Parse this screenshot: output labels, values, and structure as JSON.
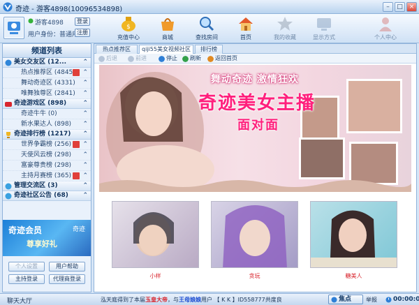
{
  "window": {
    "title": "奇迹 - 游客4898(10096534898)"
  },
  "user": {
    "name": "游客4898",
    "role_label": "用户身份：普通用户",
    "login_label": "登录",
    "register_label": "注册"
  },
  "toolbar": [
    {
      "label": "充值中心",
      "icon": "coin-bag-icon"
    },
    {
      "label": "商城",
      "icon": "shop-icon"
    },
    {
      "label": "查找房间",
      "icon": "search-icon"
    },
    {
      "label": "首页",
      "icon": "home-icon"
    },
    {
      "label": "我的收藏",
      "icon": "star-icon"
    },
    {
      "label": "显示方式",
      "icon": "display-mode-icon"
    },
    {
      "label": "个人中心",
      "icon": "person-icon"
    }
  ],
  "sidebar": {
    "title": "频道列表",
    "categories": [
      {
        "label": "美女交友区 (12...",
        "icon": "globe-icon",
        "items": [
          {
            "label": "热点推荐区 (4845)"
          },
          {
            "label": "舞动奇迹区 (4331)"
          },
          {
            "label": "唯舞独尊区 (2841)"
          }
        ]
      },
      {
        "label": "奇迹游戏区 (898)",
        "icon": "game-icon",
        "items": [
          {
            "label": "奇迹牛牛 (0)"
          },
          {
            "label": "新水果达人 (898)"
          }
        ]
      },
      {
        "label": "奇迹排行榜 (1217)",
        "icon": "trophy-icon",
        "items": [
          {
            "label": "世界争霸榜 (256)"
          },
          {
            "label": "天使风云榜 (298)"
          },
          {
            "label": "富豪尊贵榜 (298)"
          },
          {
            "label": "主持月赛榜 (365)"
          }
        ]
      },
      {
        "label": "管理交流区 (3)",
        "icon": "admin-icon",
        "items": []
      },
      {
        "label": "奇迹社区公告 (68)",
        "icon": "notice-icon",
        "items": []
      }
    ],
    "promo": {
      "line1": "奇迹会员",
      "line2": "尊享好礼",
      "brand": "奇迹"
    },
    "buttons": {
      "personal_settings": "个人设置",
      "user_help": "用户帮助",
      "host_login": "主持登录",
      "agent_login": "代理商登录"
    }
  },
  "main": {
    "tabs": [
      {
        "label": "热点推荐区 (4845)"
      },
      {
        "label": "qiji55美女视频社区"
      },
      {
        "label": "排行榜"
      }
    ],
    "nav": {
      "back": "后退",
      "forward": "前进",
      "stop": "停止",
      "refresh": "刷新",
      "home": "返回首页"
    },
    "banner": {
      "line1": "舞动奇迹  激情狂欢",
      "line2": "奇迹美女主播",
      "line3": "面对面"
    },
    "thumbnails": [
      {
        "caption": "小样"
      },
      {
        "caption": "贪玩"
      },
      {
        "caption": "糖美人"
      }
    ]
  },
  "statusbar": {
    "left": "聊天大厅",
    "marquee_prefix": "泓天庭得到了本届",
    "marquee_title": "玉皇大帝",
    "marquee_mid": "，与",
    "marquee_name": "王母娘娘",
    "marquee_suffix": "用户 【 K  K 】ID558777共度良",
    "focus_label": "焦点",
    "report_label": "举报",
    "timer": "00:00:00"
  },
  "colors": {
    "accent": "#1c7fd8",
    "alert_red": "#d8262e",
    "banner_pink": "#ff1f7c"
  }
}
